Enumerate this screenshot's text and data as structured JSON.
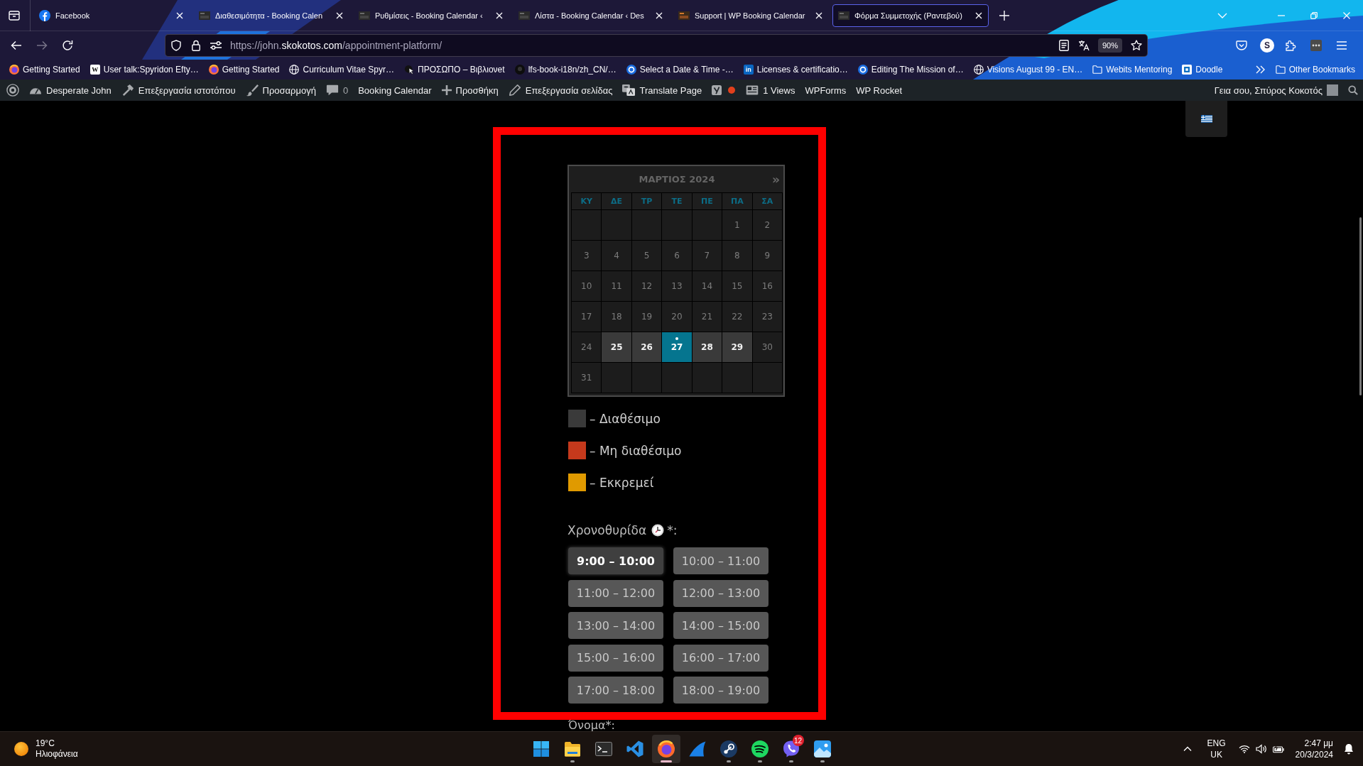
{
  "tabs": [
    {
      "title": "Facebook",
      "kind": "social",
      "selected": false
    },
    {
      "title": "Διαθεσιμότητα - Booking Calen",
      "kind": "site",
      "selected": false
    },
    {
      "title": "Ρυθμίσεις - Booking Calendar ‹",
      "kind": "site",
      "selected": false
    },
    {
      "title": "Λίστα - Booking Calendar ‹ Des",
      "kind": "site",
      "selected": false
    },
    {
      "title": "Support | WP Booking Calendar",
      "kind": "plugin",
      "selected": false
    },
    {
      "title": "Φόρμα Συμμετοχής (Ραντεβού)",
      "kind": "site",
      "selected": true
    }
  ],
  "toolbar": {
    "buttons": [
      {
        "kind": "back",
        "disabled": false
      },
      {
        "kind": "forward",
        "disabled": true
      },
      {
        "kind": "reload",
        "disabled": false
      }
    ],
    "url": {
      "prefix": "https://john.",
      "domain": "skokotos.com",
      "path": "/appointment-platform/"
    },
    "zoom": "90%",
    "account_initial": "S"
  },
  "bookmarks": {
    "items": [
      {
        "label": "Getting Started",
        "kind": "browser"
      },
      {
        "label": "User talk:Spyridon Efty…",
        "kind": "letter-light",
        "letter": "W"
      },
      {
        "label": "Getting Started",
        "kind": "browser"
      },
      {
        "label": "Curriculum Vitae Spyr…",
        "kind": "globe"
      },
      {
        "label": "ΠΡΟΣΩΠΟ – Βιβλιονet",
        "kind": "cursor"
      },
      {
        "label": "lfs-book-i18n/zh_CN/…",
        "kind": "dark"
      },
      {
        "label": "Select a Date & Time -…",
        "kind": "ring"
      },
      {
        "label": "Licenses & certificatio…",
        "kind": "letter-blue",
        "letter": "in"
      },
      {
        "label": "Editing The Mission of…",
        "kind": "ring"
      },
      {
        "label": "Visions August 99 - EN…",
        "kind": "globe"
      },
      {
        "label": "Webits Mentoring",
        "kind": "folder"
      },
      {
        "label": "Doodle",
        "kind": "tile"
      }
    ],
    "other": "Other Bookmarks"
  },
  "admin_bar": {
    "items": [
      {
        "kind": "logo"
      },
      {
        "kind": "gauge",
        "label": "Desperate John"
      },
      {
        "kind": "hammer",
        "label": "Επεξεργασία ιστοτόπου"
      },
      {
        "kind": "brush",
        "label": "Προσαρμογή"
      },
      {
        "kind": "comment",
        "label": "0"
      },
      {
        "kind": "text",
        "label": "Booking Calendar"
      },
      {
        "kind": "plus",
        "label": "Προσθήκη"
      },
      {
        "kind": "pencil",
        "label": "Επεξεργασία σελίδας"
      },
      {
        "kind": "translate",
        "label": "Translate Page"
      },
      {
        "kind": "seo"
      },
      {
        "kind": "status",
        "color": "#e2401c"
      },
      {
        "kind": "views",
        "label": "1 Views"
      },
      {
        "kind": "text",
        "label": "WPForms"
      },
      {
        "kind": "text",
        "label": "WP Rocket"
      }
    ],
    "greeting": "Γεια σου, Σπύρος Κοκοτός"
  },
  "page": {
    "calendar": {
      "title": "ΜΑΡΤΙΟΣ 2024",
      "next": "»",
      "weekdays": [
        "ΚΥ",
        "ΔΕ",
        "ΤΡ",
        "ΤΕ",
        "ΠΕ",
        "ΠΑ",
        "ΣΑ"
      ],
      "weeks": [
        [
          {
            "kind": "empty"
          },
          {
            "kind": "empty"
          },
          {
            "kind": "empty"
          },
          {
            "kind": "empty"
          },
          {
            "kind": "empty"
          },
          {
            "kind": "day",
            "label": "1",
            "available": false,
            "selected": false,
            "marked": false
          },
          {
            "kind": "day",
            "label": "2",
            "available": false,
            "selected": false,
            "marked": false
          }
        ],
        [
          {
            "kind": "day",
            "label": "3",
            "available": false,
            "selected": false,
            "marked": false
          },
          {
            "kind": "day",
            "label": "4",
            "available": false,
            "selected": false,
            "marked": false
          },
          {
            "kind": "day",
            "label": "5",
            "available": false,
            "selected": false,
            "marked": false
          },
          {
            "kind": "day",
            "label": "6",
            "available": false,
            "selected": false,
            "marked": false
          },
          {
            "kind": "day",
            "label": "7",
            "available": false,
            "selected": false,
            "marked": false
          },
          {
            "kind": "day",
            "label": "8",
            "available": false,
            "selected": false,
            "marked": false
          },
          {
            "kind": "day",
            "label": "9",
            "available": false,
            "selected": false,
            "marked": false
          }
        ],
        [
          {
            "kind": "day",
            "label": "10",
            "available": false,
            "selected": false,
            "marked": false
          },
          {
            "kind": "day",
            "label": "11",
            "available": false,
            "selected": false,
            "marked": false
          },
          {
            "kind": "day",
            "label": "12",
            "available": false,
            "selected": false,
            "marked": false
          },
          {
            "kind": "day",
            "label": "13",
            "available": false,
            "selected": false,
            "marked": false
          },
          {
            "kind": "day",
            "label": "14",
            "available": false,
            "selected": false,
            "marked": false
          },
          {
            "kind": "day",
            "label": "15",
            "available": false,
            "selected": false,
            "marked": false
          },
          {
            "kind": "day",
            "label": "16",
            "available": false,
            "selected": false,
            "marked": false
          }
        ],
        [
          {
            "kind": "day",
            "label": "17",
            "available": false,
            "selected": false,
            "marked": false
          },
          {
            "kind": "day",
            "label": "18",
            "available": false,
            "selected": false,
            "marked": false
          },
          {
            "kind": "day",
            "label": "19",
            "available": false,
            "selected": false,
            "marked": false
          },
          {
            "kind": "day",
            "label": "20",
            "available": false,
            "selected": false,
            "marked": false
          },
          {
            "kind": "day",
            "label": "21",
            "available": false,
            "selected": false,
            "marked": false
          },
          {
            "kind": "day",
            "label": "22",
            "available": false,
            "selected": false,
            "marked": false
          },
          {
            "kind": "day",
            "label": "23",
            "available": false,
            "selected": false,
            "marked": false
          }
        ],
        [
          {
            "kind": "day",
            "label": "24",
            "available": false,
            "selected": false,
            "marked": false
          },
          {
            "kind": "day",
            "label": "25",
            "available": true,
            "selected": false,
            "marked": false
          },
          {
            "kind": "day",
            "label": "26",
            "available": true,
            "selected": false,
            "marked": false
          },
          {
            "kind": "day",
            "label": "27",
            "available": true,
            "selected": true,
            "marked": true
          },
          {
            "kind": "day",
            "label": "28",
            "available": true,
            "selected": false,
            "marked": false
          },
          {
            "kind": "day",
            "label": "29",
            "available": true,
            "selected": false,
            "marked": false
          },
          {
            "kind": "day",
            "label": "30",
            "available": false,
            "selected": false,
            "marked": false
          }
        ],
        [
          {
            "kind": "day",
            "label": "31",
            "available": false,
            "selected": false,
            "marked": false
          },
          {
            "kind": "empty"
          },
          {
            "kind": "empty"
          },
          {
            "kind": "empty"
          },
          {
            "kind": "empty"
          },
          {
            "kind": "empty"
          },
          {
            "kind": "empty"
          }
        ]
      ]
    },
    "legend": [
      {
        "label": "– Διαθέσιμο",
        "color": "#3a3a3a"
      },
      {
        "label": "– Μη διαθέσιμο",
        "color": "#c5391c"
      },
      {
        "label": "– Εκκρεμεί",
        "color": "#e09a00"
      }
    ],
    "timeslot": {
      "label": "Χρονοθυρίδα",
      "suffix": "*:"
    },
    "slots": [
      {
        "label": "9:00 – 10:00",
        "selected": true
      },
      {
        "label": "10:00 – 11:00",
        "selected": false
      },
      {
        "label": "11:00 – 12:00",
        "selected": false
      },
      {
        "label": "12:00 – 13:00",
        "selected": false
      },
      {
        "label": "13:00 – 14:00",
        "selected": false
      },
      {
        "label": "14:00 – 15:00",
        "selected": false
      },
      {
        "label": "15:00 – 16:00",
        "selected": false
      },
      {
        "label": "16:00 – 17:00",
        "selected": false
      },
      {
        "label": "17:00 – 18:00",
        "selected": false
      },
      {
        "label": "18:00 – 19:00",
        "selected": false
      }
    ],
    "name_label": "Όνομα*:"
  },
  "taskbar": {
    "weather": {
      "temperature": "19°C",
      "condition": "Ηλιοφάνεια"
    },
    "apps": [
      {
        "kind": "start",
        "running": false,
        "active": false
      },
      {
        "kind": "files",
        "running": true,
        "active": false
      },
      {
        "kind": "terminal",
        "running": false,
        "active": false
      },
      {
        "kind": "editor",
        "running": false,
        "active": false
      },
      {
        "kind": "browser",
        "running": true,
        "active": true
      },
      {
        "kind": "fin",
        "running": false,
        "active": false
      },
      {
        "kind": "game",
        "running": true,
        "active": false
      },
      {
        "kind": "music",
        "running": true,
        "active": false
      },
      {
        "kind": "chat",
        "running": true,
        "active": false,
        "badge": "12"
      },
      {
        "kind": "photos",
        "running": true,
        "active": false
      }
    ],
    "language": [
      "ENG",
      "UK"
    ],
    "time": "2:47 μμ",
    "date": "20/3/2024"
  }
}
